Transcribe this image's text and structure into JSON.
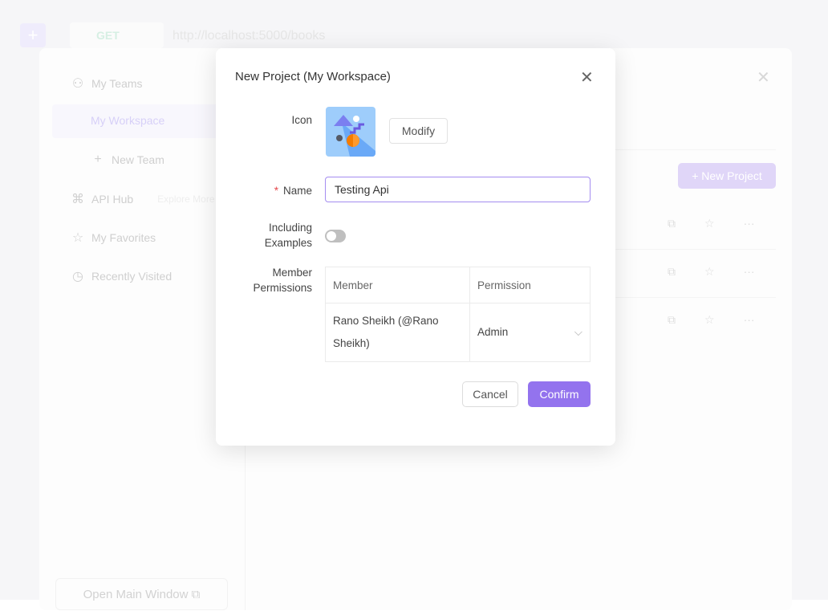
{
  "background": {
    "method": "GET",
    "url": "http://localhost:5000/books",
    "sidebar": {
      "items": [
        {
          "label": "My Teams",
          "icon": "users-icon"
        },
        {
          "label": "My Workspace"
        },
        {
          "label": "New Team",
          "icon": "plus-icon"
        },
        {
          "label": "API Hub",
          "hint": "Explore More",
          "icon": "api-hub-icon"
        },
        {
          "label": "My Favorites",
          "icon": "star-icon"
        },
        {
          "label": "Recently Visited",
          "icon": "clock-icon"
        }
      ],
      "open_main_window": "Open Main Window"
    },
    "new_project_button": "+ New Project"
  },
  "modal": {
    "title": "New Project (My Workspace)",
    "icon_label": "Icon",
    "modify_label": "Modify",
    "name_label": "Name",
    "name_value": "Testing Api",
    "examples_label_1": "Including",
    "examples_label_2": "Examples",
    "examples_enabled": false,
    "permissions_label_1": "Member",
    "permissions_label_2": "Permissions",
    "table": {
      "headers": [
        "Member",
        "Permission"
      ],
      "rows": [
        {
          "member": "Rano Sheikh (@Rano Sheikh)",
          "permission": "Admin"
        }
      ]
    },
    "cancel_label": "Cancel",
    "confirm_label": "Confirm",
    "accent_color": "#9373ee"
  }
}
